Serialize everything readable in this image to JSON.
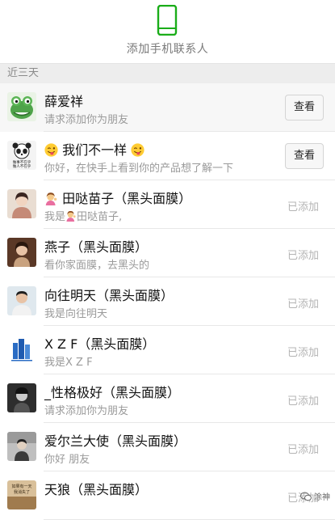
{
  "header": {
    "label": "添加手机联系人",
    "icon": "phone-icon",
    "accent": "#1aad19"
  },
  "section": {
    "title": "近三天"
  },
  "contacts": [
    {
      "name": "薛爱祥",
      "message": "请求添加你为朋友",
      "action": "查看",
      "avatar_color": "#4fa34a"
    },
    {
      "name": "我们不一样",
      "message": "你好，在快手上看到你的产品想了解一下",
      "action": "查看",
      "avatar_color": "#333333",
      "avatar_text": "做事不在乎",
      "avatar_text2": "做人不在乎"
    },
    {
      "name": "田哒苗子（黑头面膜）",
      "message_prefix": "我是",
      "message_suffix": "田哒苗子,",
      "action": "已添加",
      "avatar_color": "#c7a58f"
    },
    {
      "name": "燕子（黑头面膜）",
      "message": "看你家面膜，去黑头的",
      "action": "已添加",
      "avatar_color": "#7a4a2e"
    },
    {
      "name": "向往明天（黑头面膜）",
      "message": "我是向往明天",
      "action": "已添加",
      "avatar_color": "#6b8ea8"
    },
    {
      "name": "X Z F（黑头面膜）",
      "message": "我是X Z F",
      "action": "已添加",
      "avatar_color": "#2a6cc4"
    },
    {
      "name": "_性格极好（黑头面膜）",
      "message": "请求添加你为朋友",
      "action": "已添加",
      "avatar_color": "#2d2d2d"
    },
    {
      "name": "爱尔兰大使（黑头面膜）",
      "message": "你好 朋友",
      "action": "已添加",
      "avatar_color": "#8a8a8a"
    },
    {
      "name": "天狼（黑头面膜）",
      "message": "",
      "action": "已添加",
      "avatar_color": "#a07b4e",
      "avatar_text": "如果有一天",
      "avatar_text2": "我消失了"
    }
  ],
  "watermark": {
    "text": "涂神"
  }
}
